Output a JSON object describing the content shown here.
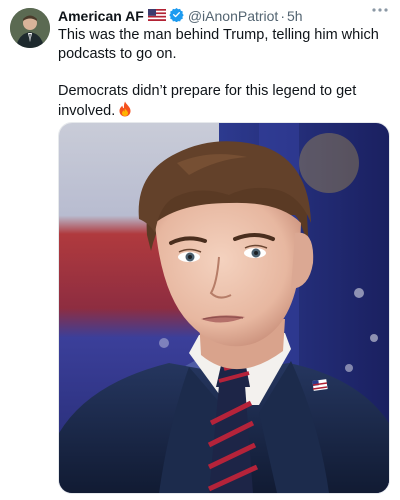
{
  "tweet": {
    "author": {
      "display_name": "American AF",
      "flag_icon": "us-flag-icon",
      "verified_icon": "blue-verified-check-icon",
      "handle": "@iAnonPatriot",
      "separator": "·",
      "time": "5h"
    },
    "more_icon": "ellipsis-icon",
    "text_line1": "This was the man behind Trump, telling him which podcasts to go on.",
    "text_line2": "Democrats didn’t prepare for this legend to get involved.",
    "text_emoji": "fire-icon",
    "media": {
      "type": "photo",
      "description_icon": "portrait-photo"
    },
    "colors": {
      "text": "#0f1419",
      "secondary": "#536471",
      "verified": "#1d9bf0",
      "suit": "#1b2a4d",
      "tie_red": "#b5233a"
    }
  }
}
